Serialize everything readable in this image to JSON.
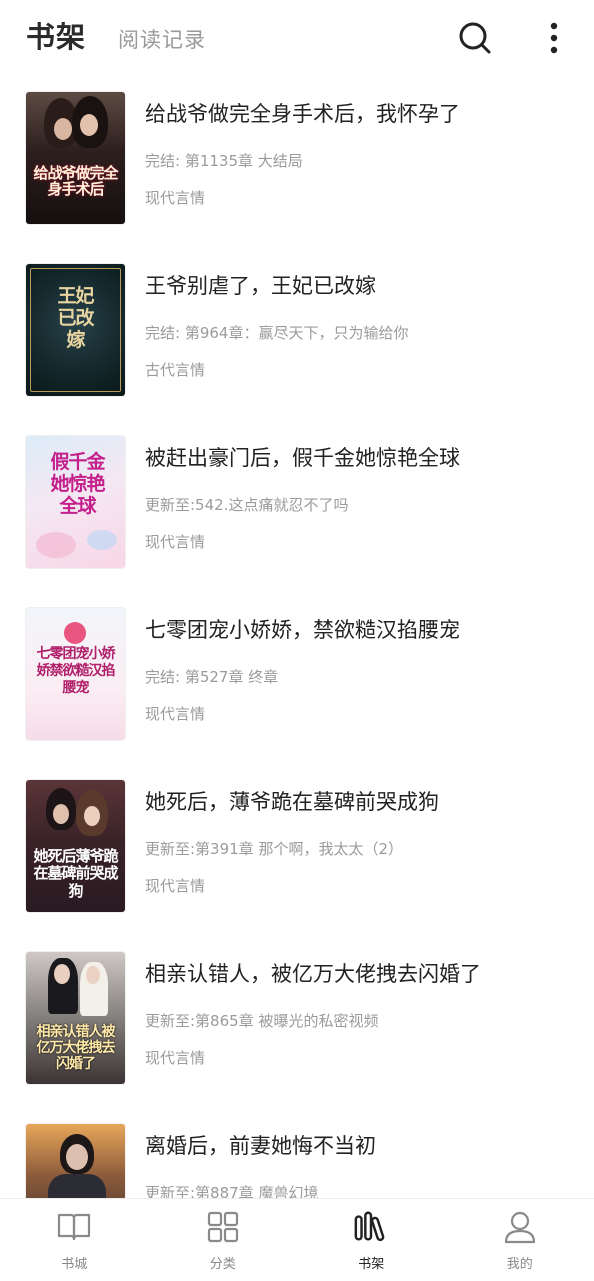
{
  "header": {
    "active_tab": "书架",
    "inactive_tab": "阅读记录",
    "search_icon": "search-icon",
    "more_icon": "more-vertical-icon"
  },
  "books": [
    {
      "title": "给战爷做完全身手术后，我怀孕了",
      "progress": "完结: 第1135章 大结局",
      "category": "现代言情",
      "cover_text": "给战爷做完全身手术后"
    },
    {
      "title": "王爷别虐了，王妃已改嫁",
      "progress": "完结: 第964章：赢尽天下，只为输给你",
      "category": "古代言情",
      "cover_text": "王妃已改嫁"
    },
    {
      "title": "被赶出豪门后，假千金她惊艳全球",
      "progress": "更新至:542.这点痛就忍不了吗",
      "category": "现代言情",
      "cover_text": "假千金她惊艳全球"
    },
    {
      "title": "七零团宠小娇娇，禁欲糙汉掐腰宠",
      "progress": "完结: 第527章 终章",
      "category": "现代言情",
      "cover_text": "七零团宠小娇娇禁欲糙汉掐腰宠"
    },
    {
      "title": "她死后，薄爷跪在墓碑前哭成狗",
      "progress": "更新至:第391章 那个啊，我太太（2）",
      "category": "现代言情",
      "cover_text": "她死后薄爷跪在墓碑前哭成狗"
    },
    {
      "title": "相亲认错人，被亿万大佬拽去闪婚了",
      "progress": "更新至:第865章 被曝光的私密视频",
      "category": "现代言情",
      "cover_text": "相亲认错人被亿万大佬拽去闪婚了"
    },
    {
      "title": "离婚后，前妻她悔不当初",
      "progress": "更新至:第887章 魔兽幻境",
      "category": "",
      "cover_text": ""
    }
  ],
  "nav": [
    {
      "label": "书城",
      "icon": "book-open-icon",
      "active": false
    },
    {
      "label": "分类",
      "icon": "grid-icon",
      "active": false
    },
    {
      "label": "书架",
      "icon": "bookshelf-icon",
      "active": true
    },
    {
      "label": "我的",
      "icon": "user-icon",
      "active": false
    }
  ],
  "colors": {
    "accent": "#222222",
    "muted": "#9b9b9b"
  }
}
